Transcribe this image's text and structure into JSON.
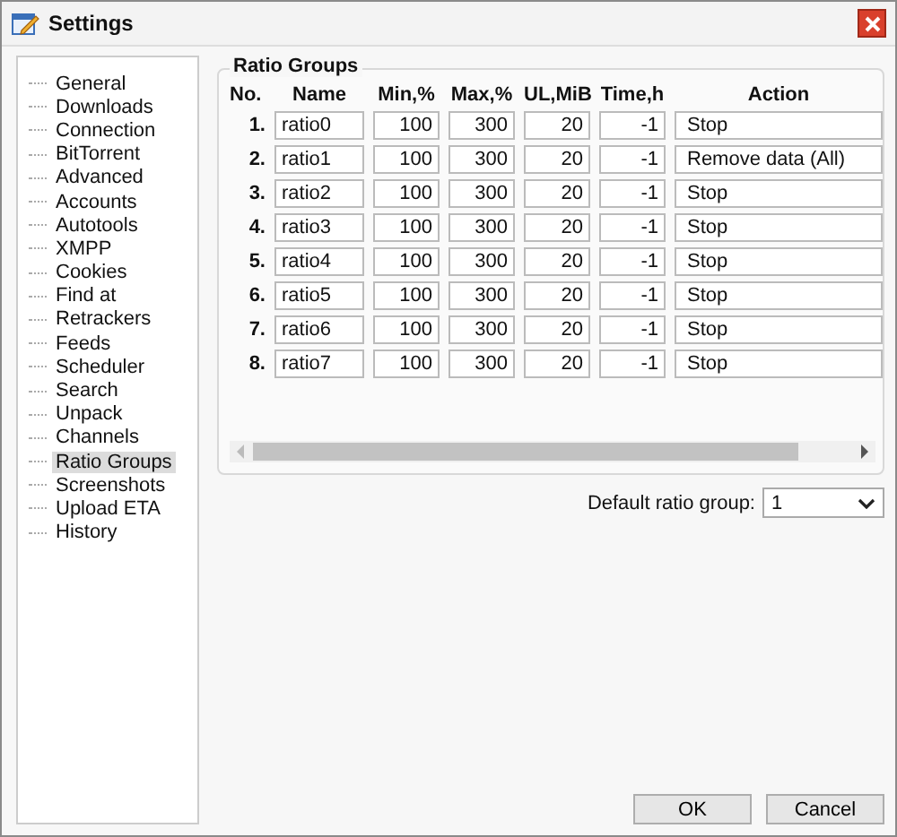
{
  "window": {
    "title": "Settings"
  },
  "sidebar": {
    "items": [
      {
        "label": "General",
        "selected": false
      },
      {
        "label": "Downloads",
        "selected": false
      },
      {
        "label": "Connection",
        "selected": false
      },
      {
        "label": "BitTorrent",
        "selected": false
      },
      {
        "label": "Advanced",
        "selected": false
      },
      {
        "label": "Accounts",
        "selected": false
      },
      {
        "label": "Autotools",
        "selected": false
      },
      {
        "label": "XMPP",
        "selected": false
      },
      {
        "label": "Cookies",
        "selected": false
      },
      {
        "label": "Find at",
        "selected": false
      },
      {
        "label": "Retrackers",
        "selected": false
      },
      {
        "label": "Feeds",
        "selected": false
      },
      {
        "label": "Scheduler",
        "selected": false
      },
      {
        "label": "Search",
        "selected": false
      },
      {
        "label": "Unpack",
        "selected": false
      },
      {
        "label": "Channels",
        "selected": false
      },
      {
        "label": "Ratio Groups",
        "selected": true
      },
      {
        "label": "Screenshots",
        "selected": false
      },
      {
        "label": "Upload ETA",
        "selected": false
      },
      {
        "label": "History",
        "selected": false
      }
    ]
  },
  "group": {
    "title": "Ratio Groups",
    "columns": [
      "No.",
      "Name",
      "Min,%",
      "Max,%",
      "UL,MiB",
      "Time,h",
      "Action"
    ],
    "rows": [
      {
        "no": "1.",
        "name": "ratio0",
        "min": "100",
        "max": "300",
        "ul": "20",
        "time": "-1",
        "action": "Stop"
      },
      {
        "no": "2.",
        "name": "ratio1",
        "min": "100",
        "max": "300",
        "ul": "20",
        "time": "-1",
        "action": "Remove data (All)"
      },
      {
        "no": "3.",
        "name": "ratio2",
        "min": "100",
        "max": "300",
        "ul": "20",
        "time": "-1",
        "action": "Stop"
      },
      {
        "no": "4.",
        "name": "ratio3",
        "min": "100",
        "max": "300",
        "ul": "20",
        "time": "-1",
        "action": "Stop"
      },
      {
        "no": "5.",
        "name": "ratio4",
        "min": "100",
        "max": "300",
        "ul": "20",
        "time": "-1",
        "action": "Stop"
      },
      {
        "no": "6.",
        "name": "ratio5",
        "min": "100",
        "max": "300",
        "ul": "20",
        "time": "-1",
        "action": "Stop"
      },
      {
        "no": "7.",
        "name": "ratio6",
        "min": "100",
        "max": "300",
        "ul": "20",
        "time": "-1",
        "action": "Stop"
      },
      {
        "no": "8.",
        "name": "ratio7",
        "min": "100",
        "max": "300",
        "ul": "20",
        "time": "-1",
        "action": "Stop"
      }
    ]
  },
  "default_group": {
    "label": "Default ratio group:",
    "value": "1"
  },
  "buttons": [
    "OK",
    "Cancel"
  ]
}
